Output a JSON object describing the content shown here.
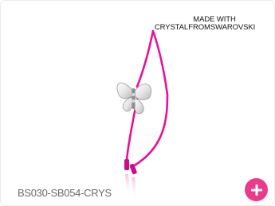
{
  "product": {
    "badge_line1": "MADE WITH",
    "badge_line2": "CRYSTAL FROMSWAROVSKI",
    "sku": "BS030-SB054-CRYS",
    "image_alt": "Pink cord bracelet with crystal butterfly charm"
  },
  "actions": {
    "add_icon": "plus-icon"
  },
  "colors": {
    "cord": "#e6119a",
    "accent_button": "#ec3a8b",
    "sku_text": "#6b6b6b"
  }
}
